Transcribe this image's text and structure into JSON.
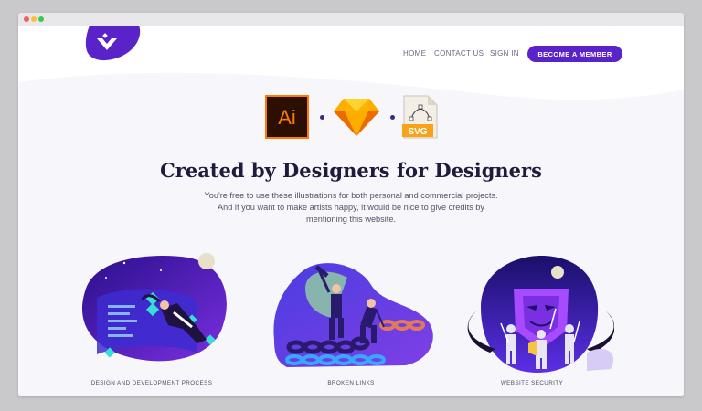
{
  "nav": {
    "links": [
      "HOME",
      "CONTACT US",
      "SIGN IN"
    ],
    "cta": "BECOME A MEMBER"
  },
  "tools": {
    "illustrator_label": "Ai",
    "svg_label": "SVG"
  },
  "hero": {
    "title": "Created by Designers for Designers",
    "description_lines": [
      "You're free to use these illustrations for both personal and commercial projects.",
      "And if you want to make artists happy, it would be nice to give credits by",
      "mentioning this website."
    ]
  },
  "cards": [
    {
      "label": "DESIGN AND DEVELOPMENT PROCESS"
    },
    {
      "label": "BROKEN LINKS"
    },
    {
      "label": "WEBSITE SECURITY"
    }
  ],
  "colors": {
    "brand": "#5a22c9",
    "heading": "#1f1b3a",
    "body": "#56526b"
  }
}
